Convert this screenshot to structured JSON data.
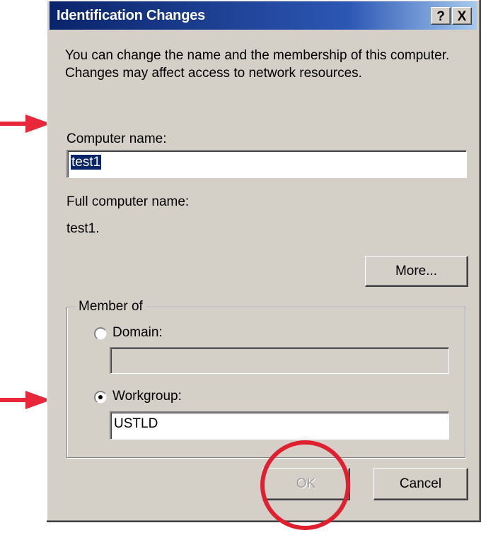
{
  "window": {
    "title": "Identification Changes",
    "help_label": "?",
    "close_label": "X"
  },
  "description": "You can change the name and the membership of this computer. Changes may affect access to network resources.",
  "computer_name": {
    "label": "Computer name:",
    "value": "test1"
  },
  "full_computer_name": {
    "label": "Full computer name:",
    "value": "test1."
  },
  "more_button": "More...",
  "member_of": {
    "legend": "Member of",
    "domain": {
      "label": "Domain:",
      "value": "",
      "selected": false
    },
    "workgroup": {
      "label": "Workgroup:",
      "value": "USTLD",
      "selected": true
    }
  },
  "buttons": {
    "ok": "OK",
    "cancel": "Cancel"
  },
  "annotations": {
    "arrow_color": "#e8283a",
    "circle_color": "#e0202e"
  },
  "colors": {
    "dialog_bg": "#d4d0c8",
    "titlebar": "#0a246a"
  }
}
